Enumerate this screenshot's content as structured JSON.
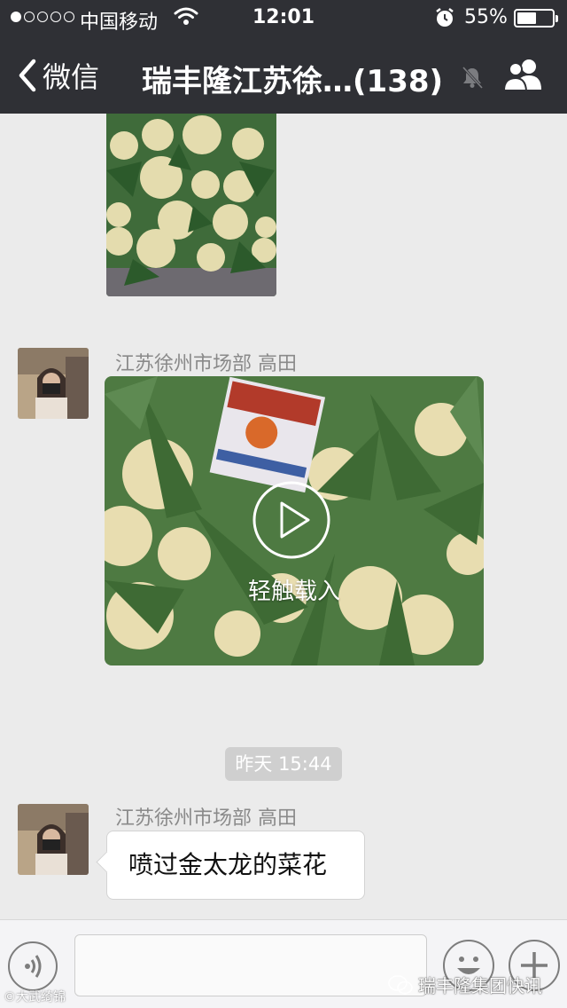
{
  "status_bar": {
    "carrier": "中国移动",
    "time": "12:01",
    "battery_percent": "55%",
    "battery_level": 0.55,
    "signal_bars_filled": 1,
    "signal_bars_total": 5
  },
  "nav": {
    "back_label": "微信",
    "title": "瑞丰隆江苏徐…(138)",
    "icons": [
      "chevron-left-icon",
      "mute-bell-icon",
      "group-members-icon"
    ]
  },
  "messages": [
    {
      "type": "image",
      "content": "cauliflower-photo"
    },
    {
      "type": "video",
      "sender": "江苏徐州市场部  高田",
      "overlay_label": "轻触载入",
      "content": "cauliflower-field-video"
    },
    {
      "type": "timestamp",
      "text": "昨天 15:44"
    },
    {
      "type": "text",
      "sender": "江苏徐州市场部  高田",
      "text": "喷过金太龙的菜花"
    }
  ],
  "input_bar": {
    "icons": [
      "voice-icon",
      "emoji-icon",
      "plus-icon"
    ]
  },
  "watermark": {
    "text": "瑞丰隆集团快讯",
    "left_text": "©大武绮锦"
  },
  "colors": {
    "header_bg": "#2f3035",
    "chat_bg": "#ebebeb",
    "bubble_bg": "#ffffff",
    "timestamp_bg": "#cfcfcf"
  }
}
